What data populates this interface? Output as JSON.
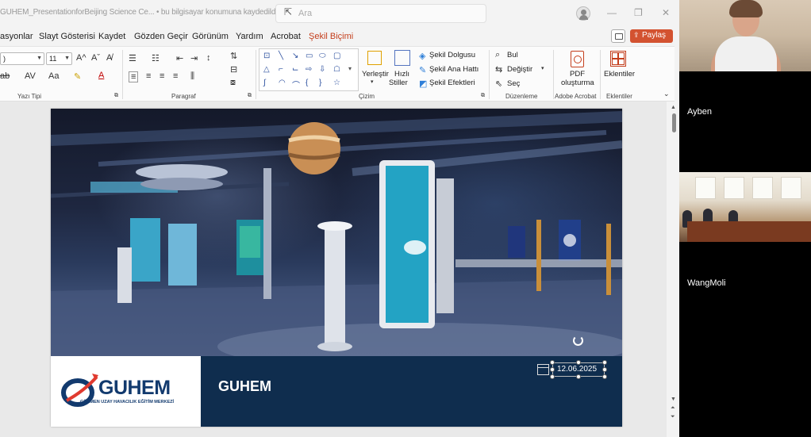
{
  "titlebar": {
    "title": "GUHEM_PresentationforBeijing Science Ce... • bu bilgisayar konumuna kaydedildi ⌄",
    "search_placeholder": "Ara",
    "minimize": "—",
    "restore": "❐",
    "close": "✕"
  },
  "tabs": [
    {
      "label": "asyonlar"
    },
    {
      "label": "Slayt Gösterisi"
    },
    {
      "label": "Kaydet"
    },
    {
      "label": "Gözden Geçir"
    },
    {
      "label": "Görünüm"
    },
    {
      "label": "Yardım"
    },
    {
      "label": "Acrobat"
    },
    {
      "label": "Şekil Biçimi"
    }
  ],
  "share_label": "Paylaş",
  "ribbon": {
    "font": {
      "name_value": ")",
      "size_value": "11",
      "label": "Yazı Tipi",
      "grow": "A^",
      "shrink": "Aˇ",
      "clear": "A̸",
      "strike": "ab",
      "spacing": "AV",
      "case": "Aa",
      "color": "A"
    },
    "paragraph": {
      "label": "Paragraf"
    },
    "drawing": {
      "label": "Çizim",
      "arrange": "Yerleştir",
      "quick_styles_1": "Hızlı",
      "quick_styles_2": "Stiller",
      "fill": "Şekil Dolgusu",
      "outline": "Şekil Ana Hattı",
      "effects": "Şekil Efektleri"
    },
    "editing": {
      "label": "Düzenleme",
      "find": "Bul",
      "replace": "Değiştir",
      "select": "Seç"
    },
    "acrobat": {
      "label": "Adobe Acrobat",
      "pdf_1": "PDF",
      "pdf_2": "oluşturma"
    },
    "addins": {
      "label": "Eklentiler",
      "button": "Eklentiler"
    }
  },
  "slide": {
    "logo_text": "GUHEM",
    "logo_sub": "GÖKMEN UZAY HAVACILIK EĞİTİM MERKEZİ",
    "title": "GUHEM",
    "date": "12.06.2025"
  },
  "participants": [
    {
      "name": "Ayben"
    },
    {
      "name": "WangMoli"
    }
  ],
  "colors": {
    "accent": "#c43e1c",
    "share": "#d35230",
    "slide_bar": "#0f2d4e",
    "logo_blue": "#123a6e"
  }
}
